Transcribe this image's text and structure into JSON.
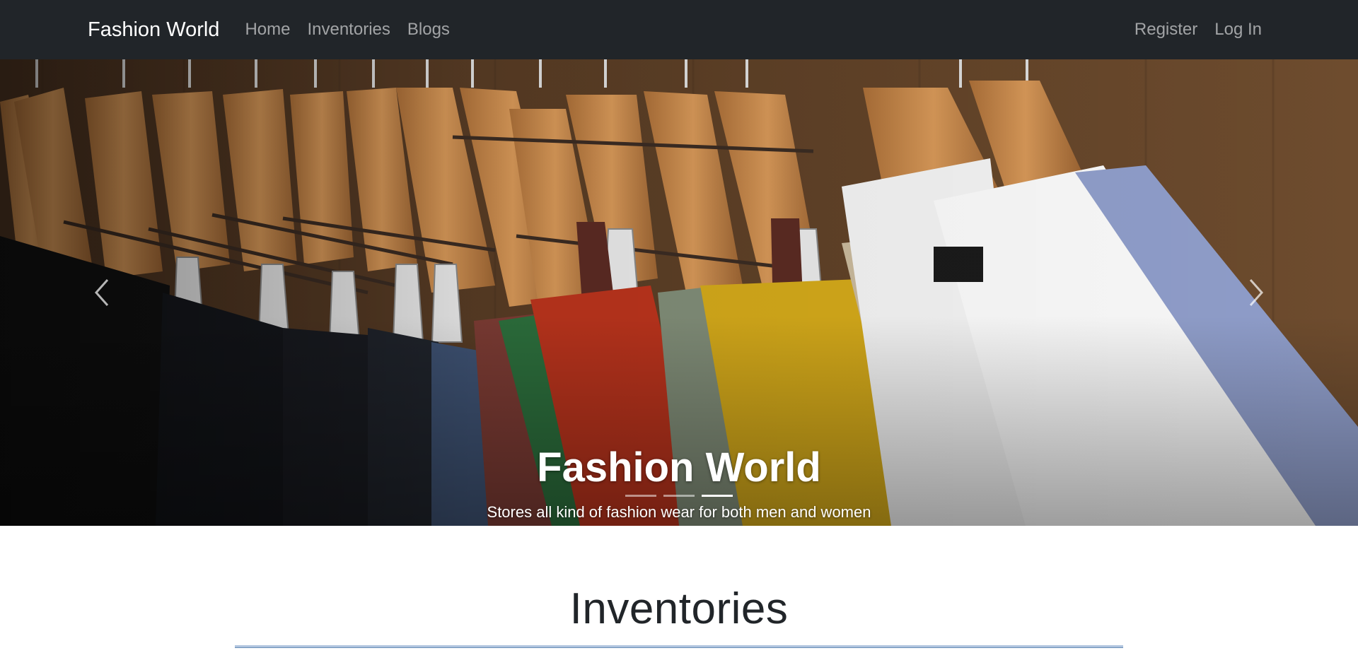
{
  "navbar": {
    "brand": "Fashion World",
    "links": [
      "Home",
      "Inventories",
      "Blogs"
    ],
    "auth": [
      "Register",
      "Log In"
    ]
  },
  "hero": {
    "title": "Fashion World",
    "subtitle": "Stores all kind of fashion wear for both men and women",
    "active_slide": 3,
    "slide_count": 3,
    "colors": {
      "wall": "#6b4a2b",
      "hanger": "#c98a4a",
      "hook": "#cfcfcf",
      "red_garment": "#c0381e",
      "yellow_garment": "#d3a819",
      "white_shirt": "#f2f2f2",
      "blue_shirt": "#8d9bc6"
    }
  },
  "section": {
    "title": "Inventories"
  }
}
